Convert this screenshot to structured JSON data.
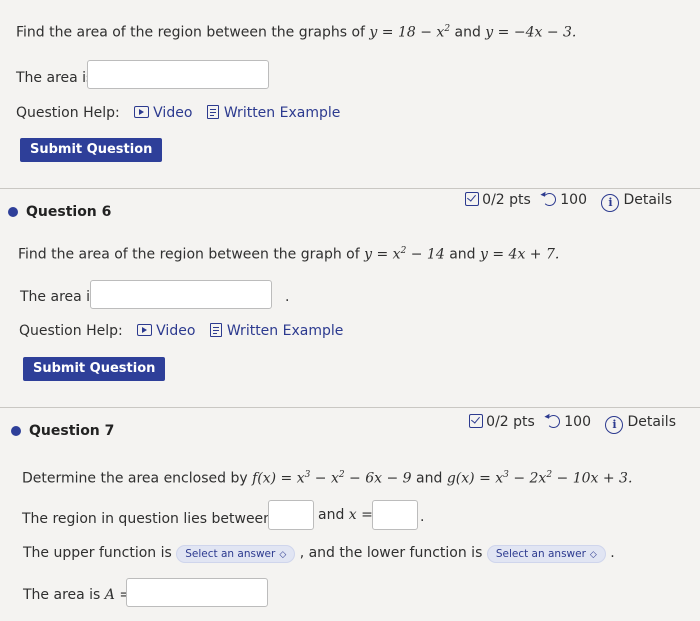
{
  "q5": {
    "prompt": "Find the area of the region between the graphs of",
    "eq1": "y = 18 − x",
    "eq1_exp": "2",
    "and": "and",
    "eq2": "y = −4x − 3.",
    "answer_label": "The area is",
    "help_label": "Question Help:",
    "video": "Video",
    "written": "Written Example",
    "submit": "Submit Question"
  },
  "q6": {
    "title": "Question 6",
    "pts": "0/2 pts",
    "retries": "100",
    "details": "Details",
    "prompt": "Find the area of the region between the graph of",
    "eq1": "y = x",
    "eq1_exp": "2",
    "eq1_tail": " − 14",
    "and": "and",
    "eq2": "y = 4x + 7.",
    "answer_label": "The area is",
    "help_label": "Question Help:",
    "video": "Video",
    "written": "Written Example",
    "submit": "Submit Question"
  },
  "q7": {
    "title": "Question 7",
    "pts": "0/2 pts",
    "retries": "100",
    "details": "Details",
    "prompt": "Determine the area enclosed by",
    "f": "f(x) = x",
    "f_e1": "3",
    "f_m": " − x",
    "f_e2": "2",
    "f_t": " − 6x − 9",
    "and": "and",
    "g": "g(x) = x",
    "g_e1": "3",
    "g_m": " − 2x",
    "g_e2": "2",
    "g_t": " − 10x + 3.",
    "region_label": "The region in question lies between",
    "x_eq": "x =",
    "and2": "and",
    "upper_label": "The upper function is",
    "select_text": "Select an answer",
    "lower_label": ", and the lower function is",
    "period": ".",
    "area_label": "The area is",
    "area_var": "A ="
  },
  "colors": {
    "accent": "#2e3f99",
    "link": "#2c3a8f",
    "background": "#f4f3f1"
  }
}
